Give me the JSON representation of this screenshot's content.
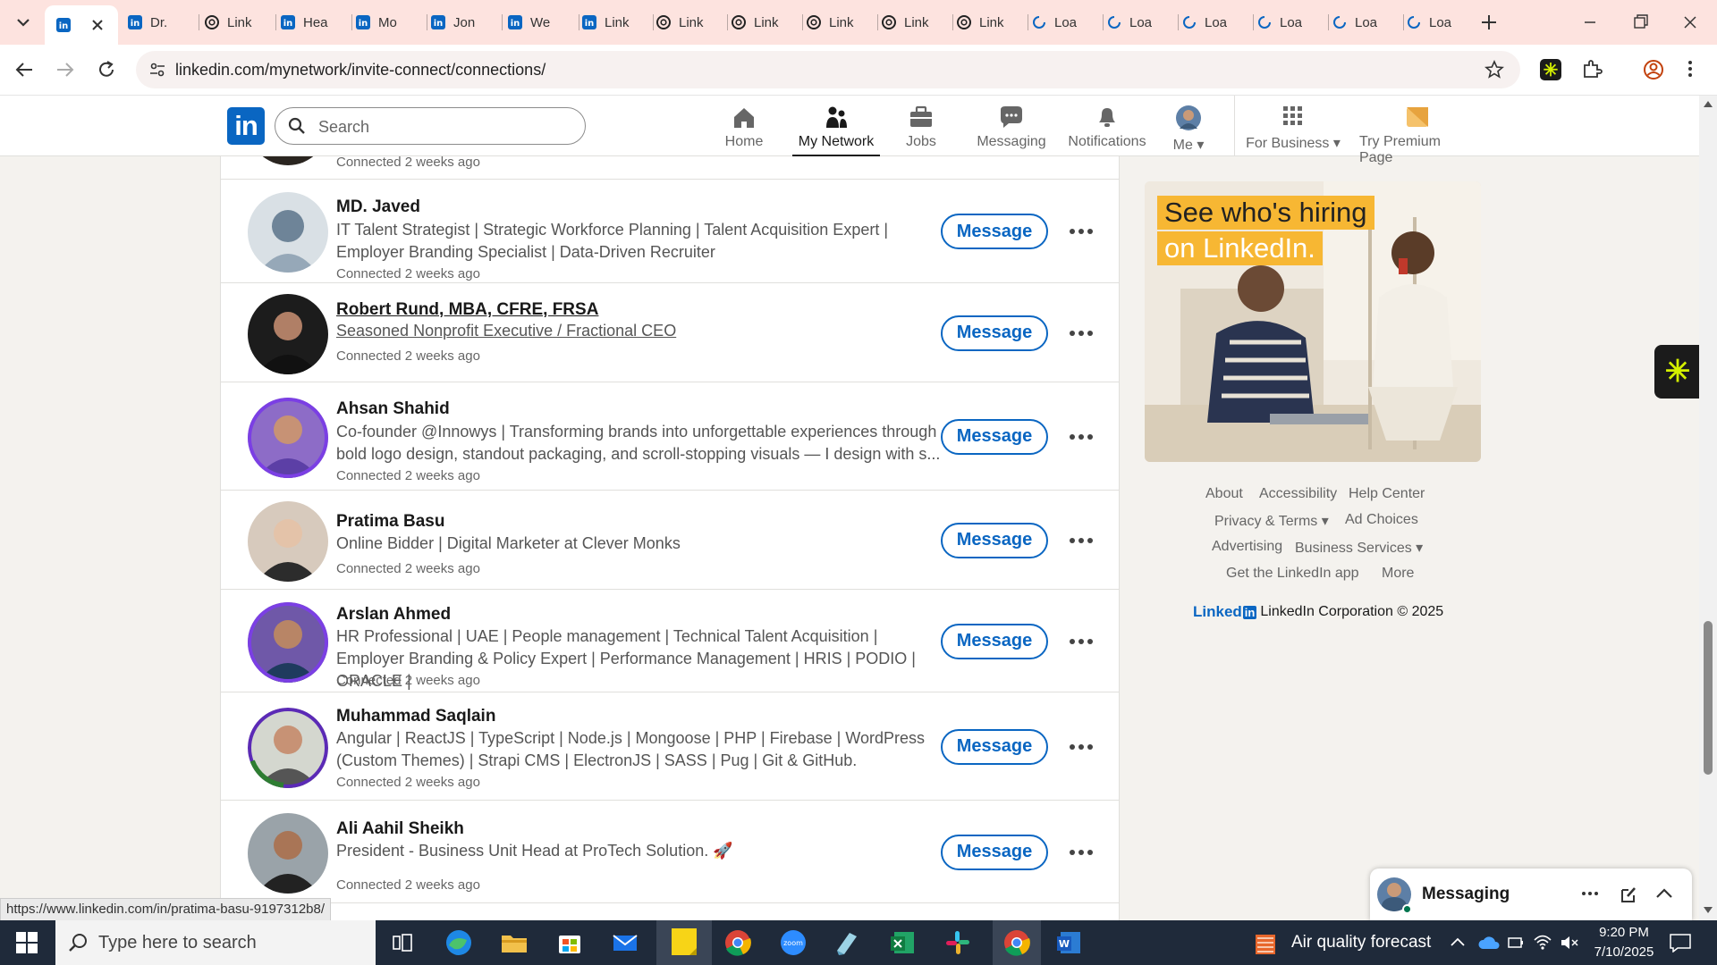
{
  "browser": {
    "tabs": [
      {
        "label": "",
        "icon": "linkedin-icon",
        "active": true
      },
      {
        "label": "Dr.",
        "icon": "linkedin-icon"
      },
      {
        "label": "Link",
        "icon": "threads-icon"
      },
      {
        "label": "Hea",
        "icon": "linkedin-icon"
      },
      {
        "label": "Mo",
        "icon": "linkedin-icon"
      },
      {
        "label": "Jon",
        "icon": "linkedin-icon"
      },
      {
        "label": "We",
        "icon": "linkedin-icon"
      },
      {
        "label": "Link",
        "icon": "linkedin-icon"
      },
      {
        "label": "Link",
        "icon": "threads-icon"
      },
      {
        "label": "Link",
        "icon": "threads-icon"
      },
      {
        "label": "Link",
        "icon": "threads-icon"
      },
      {
        "label": "Link",
        "icon": "threads-icon"
      },
      {
        "label": "Link",
        "icon": "threads-icon"
      },
      {
        "label": "Loa",
        "icon": "loading-icon"
      },
      {
        "label": "Loa",
        "icon": "loading-icon"
      },
      {
        "label": "Loa",
        "icon": "loading-icon"
      },
      {
        "label": "Loa",
        "icon": "loading-icon"
      },
      {
        "label": "Loa",
        "icon": "loading-icon"
      },
      {
        "label": "Loa",
        "icon": "loading-icon"
      }
    ],
    "url": "linkedin.com/mynetwork/invite-connect/connections/",
    "status_url": "https://www.linkedin.com/in/pratima-basu-9197312b8/"
  },
  "linkedin": {
    "logo": "in",
    "search_placeholder": "Search",
    "nav": [
      {
        "label": "Home",
        "icon": "home-icon"
      },
      {
        "label": "My Network",
        "icon": "network-icon",
        "active": true
      },
      {
        "label": "Jobs",
        "icon": "briefcase-icon"
      },
      {
        "label": "Messaging",
        "icon": "messaging-icon"
      },
      {
        "label": "Notifications",
        "icon": "bell-icon"
      },
      {
        "label": "Me",
        "icon": "avatar-icon"
      },
      {
        "label": "For Business",
        "icon": "grid-icon"
      },
      {
        "label": "Try Premium Page",
        "icon": "premium-icon"
      }
    ],
    "top_partial_conn": "Connected 2 weeks ago",
    "connections": [
      {
        "name": "MD. Javed",
        "headline": "IT Talent Strategist | Strategic Workforce Planning | Talent Acquisition Expert | Employer Branding Specialist | Data-Driven Recruiter",
        "connected": "Connected 2 weeks ago",
        "message": "Message"
      },
      {
        "name": "Robert Rund, MBA, CFRE, FRSA",
        "headline": "Seasoned Nonprofit Executive / Fractional CEO",
        "connected": "Connected 2 weeks ago",
        "message": "Message"
      },
      {
        "name": "Ahsan Shahid",
        "headline": "Co-founder @Innowys | Transforming brands into unforgettable experiences through bold logo design, standout packaging, and scroll-stopping visuals — I design with s...",
        "connected": "Connected 2 weeks ago",
        "message": "Message"
      },
      {
        "name": "Pratima Basu",
        "headline": "Online Bidder | Digital Marketer at Clever Monks",
        "connected": "Connected 2 weeks ago",
        "message": "Message"
      },
      {
        "name": "Arslan Ahmed",
        "headline": "HR Professional | UAE | People management | Technical Talent Acquisition | Employer Branding & Policy Expert | Performance Management | HRIS | PODIO | ORACLE |",
        "connected": "Connected 2 weeks ago",
        "message": "Message"
      },
      {
        "name": "Muhammad Saqlain",
        "headline": "Angular | ReactJS | TypeScript | Node.js | Mongoose | PHP | Firebase | WordPress (Custom Themes) | Strapi CMS | ElectronJS | SASS | Pug | Git & GitHub.",
        "connected": "Connected 2 weeks ago",
        "message": "Message"
      },
      {
        "name": "Ali Aahil Sheikh",
        "headline": "President - Business Unit Head at ProTech Solution. 🚀",
        "connected": "Connected 2 weeks ago",
        "message": "Message"
      }
    ],
    "ad": {
      "line1": "See who's hiring",
      "line2": "on LinkedIn."
    },
    "footer": {
      "about": "About",
      "accessibility": "Accessibility",
      "help": "Help Center",
      "privacy": "Privacy & Terms",
      "adchoices": "Ad Choices",
      "advertising": "Advertising",
      "business": "Business Services",
      "app": "Get the LinkedIn app",
      "more": "More",
      "brand": "Linked",
      "brand_in": "in",
      "copyright": "LinkedIn Corporation © 2025"
    },
    "messaging": {
      "label": "Messaging"
    }
  },
  "taskbar": {
    "search_placeholder": "Type here to search",
    "weather": "Air quality forecast",
    "time": "9:20 PM",
    "date": "7/10/2025"
  },
  "colors": {
    "accent": "#0a66c2",
    "tabstrip": "#fde3df"
  }
}
